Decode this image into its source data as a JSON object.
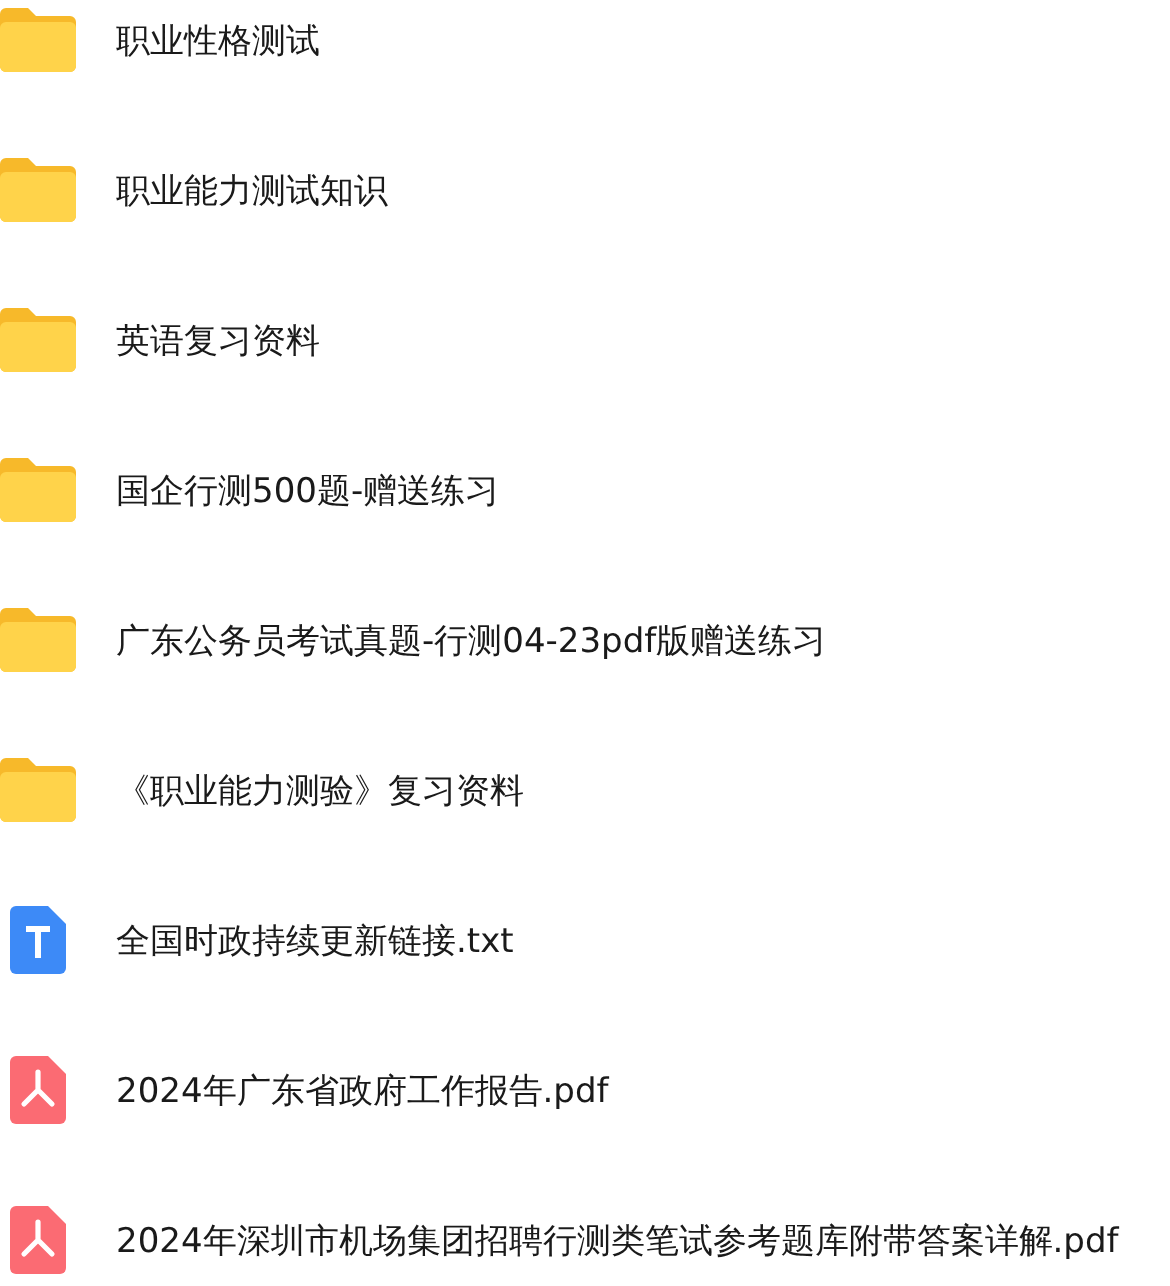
{
  "files": [
    {
      "kind": "folder",
      "name": "职业性格测试"
    },
    {
      "kind": "folder",
      "name": "职业能力测试知识"
    },
    {
      "kind": "folder",
      "name": "英语复习资料"
    },
    {
      "kind": "folder",
      "name": "国企行测500题-赠送练习"
    },
    {
      "kind": "folder",
      "name": "广东公务员考试真题-行测04-23pdf版赠送练习"
    },
    {
      "kind": "folder",
      "name": "《职业能力测验》复习资料"
    },
    {
      "kind": "txt",
      "name": "全国时政持续更新链接.txt"
    },
    {
      "kind": "pdf",
      "name": "2024年广东省政府工作报告.pdf"
    },
    {
      "kind": "pdf",
      "name": "2024年深圳市机场集团招聘行测类笔试参考题库附带答案详解.pdf"
    }
  ]
}
